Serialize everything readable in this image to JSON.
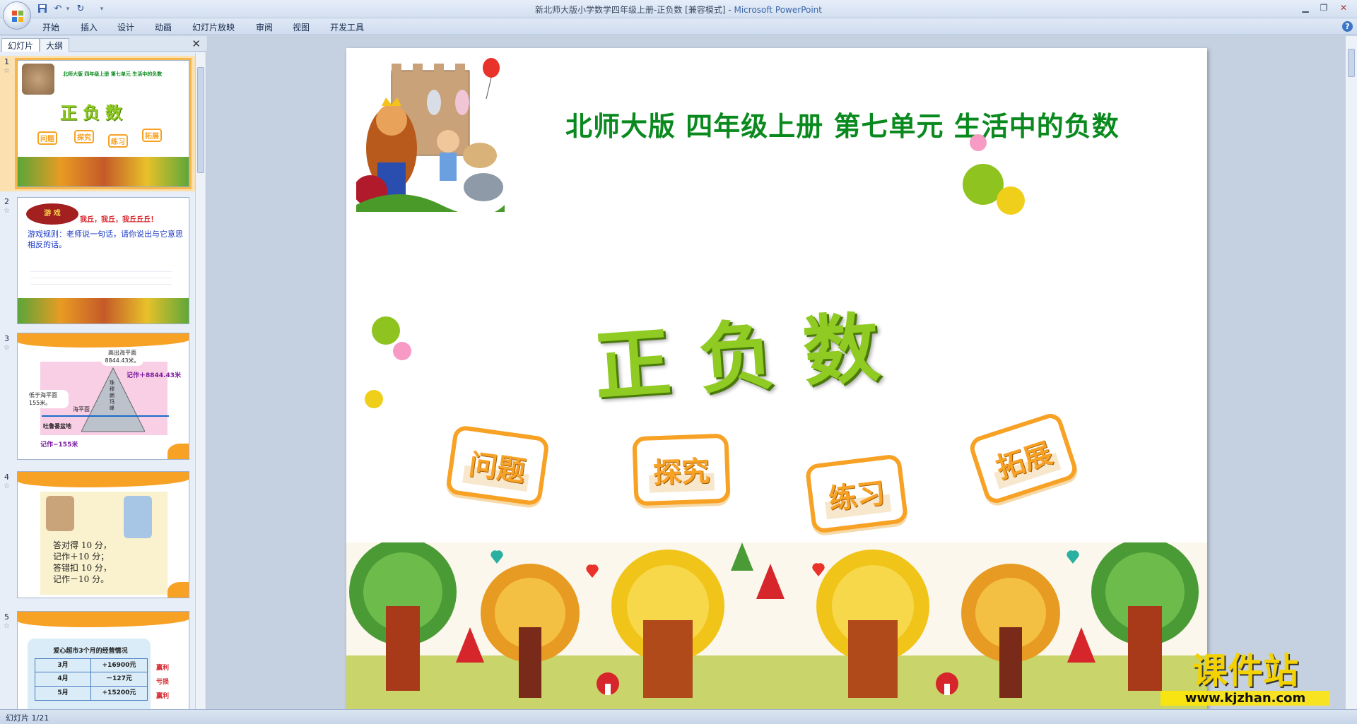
{
  "window": {
    "title_doc": "新北师大版小学数学四年级上册-正负数 [兼容模式]",
    "title_sep": " - ",
    "title_app": "Microsoft PowerPoint"
  },
  "ribbon": {
    "tabs": [
      "开始",
      "插入",
      "设计",
      "动画",
      "幻灯片放映",
      "审阅",
      "视图",
      "开发工具"
    ]
  },
  "leftpane": {
    "tab_slides": "幻灯片",
    "tab_outline": "大纲",
    "close_glyph": "✕",
    "thumbnails": [
      {
        "num": "1",
        "title": "北师大版 四年级上册 第七单元 生活中的负数",
        "main": "正负数",
        "tags": [
          "问题",
          "探究",
          "练习",
          "拓展"
        ]
      },
      {
        "num": "2",
        "header": "游 戏",
        "line1": "我丘，我丘，我丘丘丘！",
        "rule": "游戏规则：老师说一句话，请你说出与它意思相反的话。"
      },
      {
        "num": "3",
        "top_label": "高出海平面8844.43米。",
        "record_pos": "记作＋8844.43米",
        "low_label": "低于海平面155米。",
        "sea": "海平面",
        "peak": "珠穆朗玛峰",
        "basin": "吐鲁番盆地",
        "record_neg": "记作−155米"
      },
      {
        "num": "4",
        "lines": [
          "答对得 10 分，",
          "记作＋10 分；",
          "答错扣 10 分，",
          "记作－10 分。"
        ]
      },
      {
        "num": "5",
        "table_title": "爱心超市3个月的经营情况",
        "rows": [
          {
            "month": "3月",
            "value": "+16900元",
            "note": "赢利"
          },
          {
            "month": "4月",
            "value": "－127元",
            "note": "亏损"
          },
          {
            "month": "5月",
            "value": "+15200元",
            "note": "赢利"
          }
        ]
      }
    ]
  },
  "slide": {
    "title": "北师大版  四年级上册  第七单元  生活中的负数",
    "main": "正负数",
    "tags": [
      "问题",
      "探究",
      "练习",
      "拓展"
    ]
  },
  "watermark": {
    "line1": "课件站",
    "line2": "www.kjzhan.com"
  },
  "status": {
    "slide_counter": "幻灯片 1/21"
  },
  "colors": {
    "title_green": "#0a8a1e",
    "main_green": "#8fcb22",
    "tag_orange": "#f7a125",
    "dot_pink": "#f79ac4",
    "dot_green": "#8fc31f",
    "dot_yellow": "#f0cf1a"
  }
}
